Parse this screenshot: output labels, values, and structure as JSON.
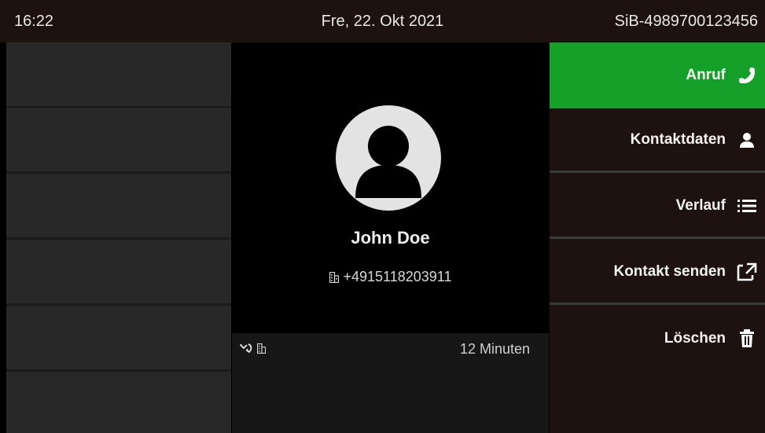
{
  "statusbar": {
    "time": "16:22",
    "date": "Fre, 22. Okt 2021",
    "device_id": "SiB-4989700123456"
  },
  "contact": {
    "name": "John Doe",
    "number": "+4915118203911",
    "number_type_icon": "building-icon",
    "avatar_icon": "person-avatar-icon"
  },
  "history": {
    "call_type_icon": "missed-call-icon",
    "number_type_icon": "building-icon",
    "duration": "12 Minuten"
  },
  "actions": [
    {
      "label": "Anruf",
      "icon": "phone-icon",
      "selected": true
    },
    {
      "label": "Kontaktdaten",
      "icon": "person-icon",
      "selected": false
    },
    {
      "label": "Verlauf",
      "icon": "list-icon",
      "selected": false
    },
    {
      "label": "Kontakt senden",
      "icon": "share-icon",
      "selected": false
    },
    {
      "label": "Löschen",
      "icon": "trash-icon",
      "selected": false
    }
  ],
  "colors": {
    "accent": "#15a02a",
    "background": "#000000",
    "panel": "#1d1210"
  }
}
